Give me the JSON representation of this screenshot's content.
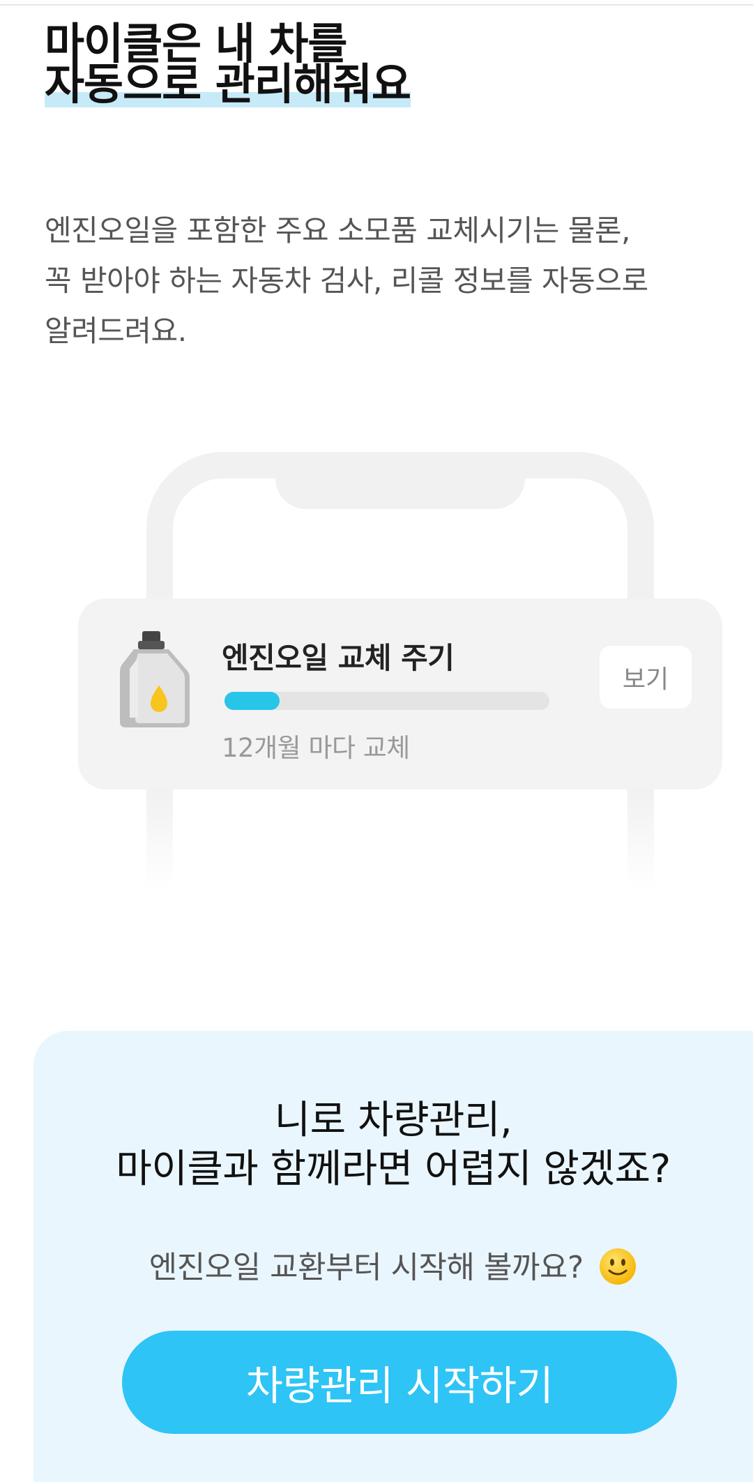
{
  "hero": {
    "title_line1": "마이클은 내 차를",
    "title_line2": "자동으로 관리해줘요",
    "highlight_color": "#c7eaf8"
  },
  "description": {
    "line1": "엔진오일을 포함한 주요 소모품 교체시기는 물론,",
    "line2": "꼭 받아야 하는 자동차 검사, 리콜 정보를 자동으로",
    "line3": "알려드려요."
  },
  "illustration": {
    "card_title": "엔진오일 교체 주기",
    "card_subtitle": "12개월 마다 교체",
    "view_button": "보기",
    "progress_fraction": 0.17,
    "progress_color": "#27c5e8",
    "icon": "oil-bottle-icon"
  },
  "cta": {
    "title_line1": "니로 차량관리,",
    "title_line2": "마이클과 함께라면 어렵지 않겠죠?",
    "subtitle": "엔진오일 교환부터 시작해 볼까요?",
    "emoji_icon": "smiley-icon",
    "start_button": "차량관리 시작하기",
    "button_color": "#2ec4f5",
    "panel_color": "#eaf6fd"
  }
}
